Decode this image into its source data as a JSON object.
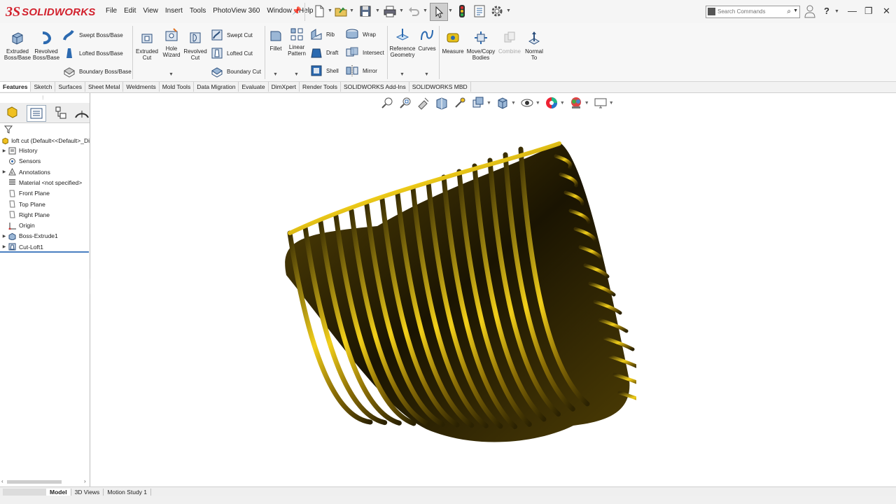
{
  "app": {
    "brand": "SOLIDWORKS",
    "logo_mark": "3S"
  },
  "menu": [
    "File",
    "Edit",
    "View",
    "Insert",
    "Tools",
    "PhotoView 360",
    "Window",
    "Help"
  ],
  "search": {
    "placeholder": "Search Commands"
  },
  "window_controls": {
    "help": "?",
    "minimize": "—",
    "restore": "❐",
    "close": "✕"
  },
  "ribbon": {
    "extruded_boss": "Extruded Boss/Base",
    "revolved_boss": "Revolved Boss/Base",
    "swept_boss": "Swept Boss/Base",
    "lofted_boss": "Lofted Boss/Base",
    "boundary_boss": "Boundary Boss/Base",
    "extruded_cut": "Extruded Cut",
    "hole_wizard": "Hole Wizard",
    "revolved_cut": "Revolved Cut",
    "swept_cut": "Swept Cut",
    "lofted_cut": "Lofted Cut",
    "boundary_cut": "Boundary Cut",
    "fillet": "Fillet",
    "linear_pattern": "Linear Pattern",
    "rib": "Rib",
    "draft": "Draft",
    "shell": "Shell",
    "wrap": "Wrap",
    "intersect": "Intersect",
    "mirror": "Mirror",
    "reference_geometry": "Reference Geometry",
    "curves": "Curves",
    "measure": "Measure",
    "move_copy": "Move/Copy Bodies",
    "combine": "Combine",
    "normal_to": "Normal To"
  },
  "tabs": [
    "Features",
    "Sketch",
    "Surfaces",
    "Sheet Metal",
    "Weldments",
    "Mold Tools",
    "Data Migration",
    "Evaluate",
    "DimXpert",
    "Render Tools",
    "SOLIDWORKS Add-Ins",
    "SOLIDWORKS MBD"
  ],
  "active_tab": "Features",
  "tree": {
    "root": "loft cut  (Default<<Default>_Di",
    "items": [
      {
        "label": "History",
        "expandable": true,
        "icon": "history-icon"
      },
      {
        "label": "Sensors",
        "expandable": false,
        "icon": "sensor-icon"
      },
      {
        "label": "Annotations",
        "expandable": true,
        "icon": "annotation-icon"
      },
      {
        "label": "Material <not specified>",
        "expandable": false,
        "icon": "material-icon"
      },
      {
        "label": "Front Plane",
        "expandable": false,
        "icon": "plane-icon"
      },
      {
        "label": "Top Plane",
        "expandable": false,
        "icon": "plane-icon"
      },
      {
        "label": "Right Plane",
        "expandable": false,
        "icon": "plane-icon"
      },
      {
        "label": "Origin",
        "expandable": false,
        "icon": "origin-icon"
      },
      {
        "label": "Boss-Extrude1",
        "expandable": true,
        "icon": "extrude-feature-icon"
      },
      {
        "label": "Cut-Loft1",
        "expandable": true,
        "icon": "loft-feature-icon"
      }
    ]
  },
  "bottom_tabs": [
    "Model",
    "3D Views",
    "Motion Study 1"
  ],
  "active_bottom_tab": "Model",
  "colors": {
    "brand_red": "#d2212d",
    "gold": "#d4a90a",
    "accent_blue": "#3a7bd5"
  }
}
